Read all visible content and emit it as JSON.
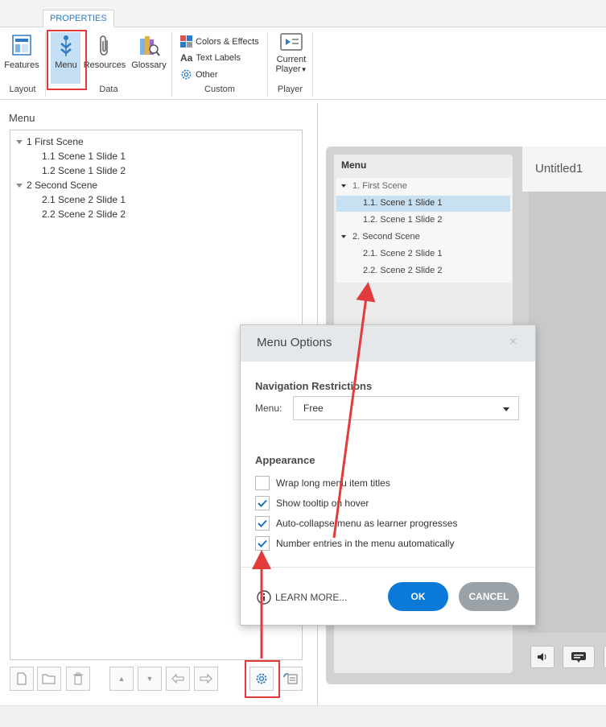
{
  "ribbon": {
    "tab": "PROPERTIES",
    "buttons": {
      "features": "Features",
      "menu": "Menu",
      "resources": "Resources",
      "glossary": "Glossary",
      "current_player_line1": "Current",
      "current_player_line2": "Player"
    },
    "custom_items": {
      "colors": "Colors & Effects",
      "text_labels": "Text Labels",
      "text_labels_icon": "Aa",
      "other": "Other"
    },
    "groups": {
      "layout": "Layout",
      "data": "Data",
      "custom": "Custom",
      "player": "Player"
    }
  },
  "left_panel": {
    "title": "Menu",
    "tree": [
      {
        "label": "1 First Scene",
        "level": 0
      },
      {
        "label": "1.1 Scene 1 Slide 1",
        "level": 1
      },
      {
        "label": "1.2 Scene 1 Slide 2",
        "level": 1
      },
      {
        "label": "2 Second Scene",
        "level": 0
      },
      {
        "label": "2.1 Scene 2 Slide 1",
        "level": 1
      },
      {
        "label": "2.2 Scene 2 Slide 2",
        "level": 1
      }
    ]
  },
  "preview": {
    "menu_tab": "Menu",
    "title": "Untitled1",
    "items": [
      {
        "label": "1. First Scene",
        "level": 0
      },
      {
        "label": "1.1. Scene 1 Slide 1",
        "level": 1,
        "selected": true
      },
      {
        "label": "1.2. Scene 1 Slide 2",
        "level": 1
      },
      {
        "label": "2. Second Scene",
        "level": 0
      },
      {
        "label": "2.1. Scene 2 Slide 1",
        "level": 1
      },
      {
        "label": "2.2. Scene 2 Slide 2",
        "level": 1
      }
    ]
  },
  "dialog": {
    "title": "Menu Options",
    "close": "×",
    "nav_section": "Navigation Restrictions",
    "menu_label": "Menu:",
    "menu_value": "Free",
    "appearance_section": "Appearance",
    "options": [
      {
        "label": "Wrap long menu item titles",
        "checked": false
      },
      {
        "label": "Show tooltip on hover",
        "checked": true
      },
      {
        "label": "Auto-collapse menu as learner progresses",
        "checked": true
      },
      {
        "label": "Number entries in the menu automatically",
        "checked": true
      }
    ],
    "learn_more": "LEARN MORE...",
    "ok": "OK",
    "cancel": "CANCEL"
  },
  "colors": {
    "accent": "#0a79d8",
    "annotation_red": "#e23b3b",
    "selection": "#c7e1f3",
    "cancel_gray": "#9aa1a7"
  }
}
